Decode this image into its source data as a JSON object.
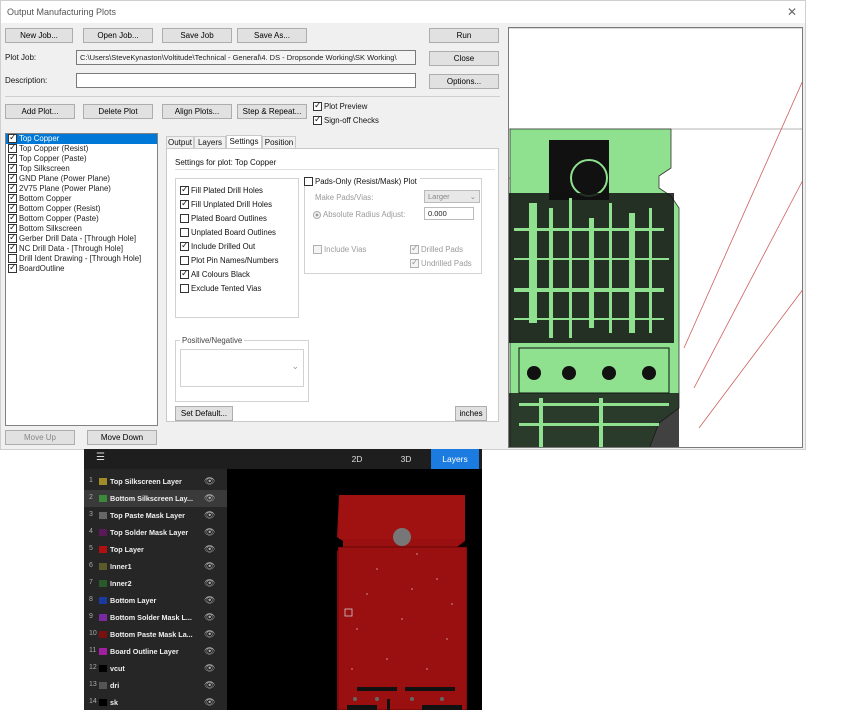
{
  "window": {
    "title": "Output Manufacturing Plots",
    "close_glyph": "✕"
  },
  "toolbar": {
    "new_job": "New Job...",
    "open_job": "Open Job...",
    "save_job": "Save Job",
    "save_as": "Save As...",
    "run": "Run",
    "close": "Close",
    "options": "Options..."
  },
  "plot_job": {
    "label": "Plot Job:",
    "value": "C:\\Users\\SteveKynaston\\Voltitude\\Technical - General\\4. DS - Dropsonde Working\\SK Working\\"
  },
  "description": {
    "label": "Description:",
    "value": ""
  },
  "actions": {
    "add_plot": "Add Plot...",
    "delete_plot": "Delete Plot",
    "align_plots": "Align Plots...",
    "step_repeat": "Step & Repeat...",
    "plot_preview": "Plot Preview",
    "signoff_checks": "Sign-off Checks"
  },
  "plots": [
    {
      "label": "Top Copper",
      "checked": true,
      "selected": true
    },
    {
      "label": "Top Copper (Resist)",
      "checked": true
    },
    {
      "label": "Top Copper (Paste)",
      "checked": true
    },
    {
      "label": "Top Silkscreen",
      "checked": true
    },
    {
      "label": "GND Plane (Power Plane)",
      "checked": true
    },
    {
      "label": "2V75 Plane (Power Plane)",
      "checked": true
    },
    {
      "label": "Bottom Copper",
      "checked": true
    },
    {
      "label": "Bottom Copper (Resist)",
      "checked": true
    },
    {
      "label": "Bottom Copper (Paste)",
      "checked": true
    },
    {
      "label": "Bottom Silkscreen",
      "checked": true
    },
    {
      "label": "Gerber Drill Data - [Through Hole]",
      "checked": true
    },
    {
      "label": "NC Drill Data - [Through Hole]",
      "checked": true
    },
    {
      "label": "Drill Ident Drawing - [Through Hole]",
      "checked": false
    },
    {
      "label": "BoardOutline",
      "checked": true
    }
  ],
  "move": {
    "up": "Move Up",
    "down": "Move Down"
  },
  "tabs": [
    "Output",
    "Layers",
    "Settings",
    "Position"
  ],
  "settings": {
    "heading": "Settings for plot: Top Copper",
    "options": [
      {
        "label": "Fill Plated Drill Holes",
        "checked": true
      },
      {
        "label": "Fill Unplated Drill Holes",
        "checked": true
      },
      {
        "label": "Plated Board Outlines",
        "checked": false
      },
      {
        "label": "Unplated Board Outlines",
        "checked": false
      },
      {
        "label": "Include Drilled Out",
        "checked": true
      },
      {
        "label": "Plot Pin Names/Numbers",
        "checked": false
      },
      {
        "label": "All Colours Black",
        "checked": true
      },
      {
        "label": "Exclude Tented Vias",
        "checked": false
      }
    ],
    "pads_only": "Pads-Only (Resist/Mask) Plot",
    "make_pads": "Make Pads/Vias:",
    "make_pads_value": "Larger",
    "abs_radius": "Absolute Radius Adjust:",
    "abs_radius_value": "0.000",
    "include_vias": "Include Vias",
    "drilled_pads": "Drilled Pads",
    "undrilled_pads": "Undrilled Pads",
    "posneg_label": "Positive/Negative",
    "set_default": "Set Default...",
    "units": "inches"
  },
  "viewer": {
    "tabs": [
      "2D",
      "3D",
      "Layers"
    ],
    "menu_glyph": "☰",
    "eye_glyph": "👁",
    "layers": [
      {
        "num": "1",
        "name": "Top Silkscreen Layer",
        "color": "#a08a2a"
      },
      {
        "num": "2",
        "name": "Bottom Silkscreen Lay...",
        "color": "#3a8a3a"
      },
      {
        "num": "3",
        "name": "Top Paste Mask Layer",
        "color": "#666666"
      },
      {
        "num": "4",
        "name": "Top Solder Mask Layer",
        "color": "#5a1a5a"
      },
      {
        "num": "5",
        "name": "Top Layer",
        "color": "#b01010"
      },
      {
        "num": "6",
        "name": "Inner1",
        "color": "#5a5a2a"
      },
      {
        "num": "7",
        "name": "Inner2",
        "color": "#2a5a2a"
      },
      {
        "num": "8",
        "name": "Bottom Layer",
        "color": "#1a3aa0"
      },
      {
        "num": "9",
        "name": "Bottom Solder Mask L...",
        "color": "#7a2aa0"
      },
      {
        "num": "10",
        "name": "Bottom Paste Mask La...",
        "color": "#7a1010"
      },
      {
        "num": "11",
        "name": "Board Outline Layer",
        "color": "#a020a0"
      },
      {
        "num": "12",
        "name": "vcut",
        "color": "#000000"
      },
      {
        "num": "13",
        "name": "dri",
        "color": "#555555"
      },
      {
        "num": "14",
        "name": "sk",
        "color": "#000000"
      }
    ]
  }
}
